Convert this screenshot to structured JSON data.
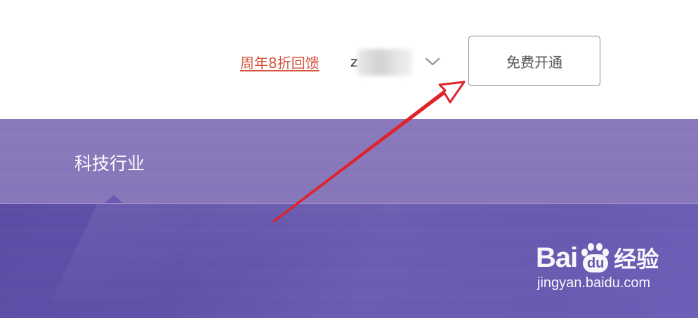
{
  "header": {
    "promo_link": "周年8折回馈",
    "user_initial": "z",
    "open_button": "免费开通"
  },
  "banner": {
    "nav_tab": "科技行业"
  },
  "watermark": {
    "logo_bai": "Bai",
    "logo_du": "du",
    "logo_suffix": "经验",
    "url": "jingyan.baidu.com"
  },
  "icons": {
    "dropdown": "chevron-down-icon",
    "annotation": "red-arrow-icon"
  },
  "colors": {
    "promo": "#d6533f",
    "banner": "#6a5bb1",
    "arrow": "#e0222a"
  }
}
